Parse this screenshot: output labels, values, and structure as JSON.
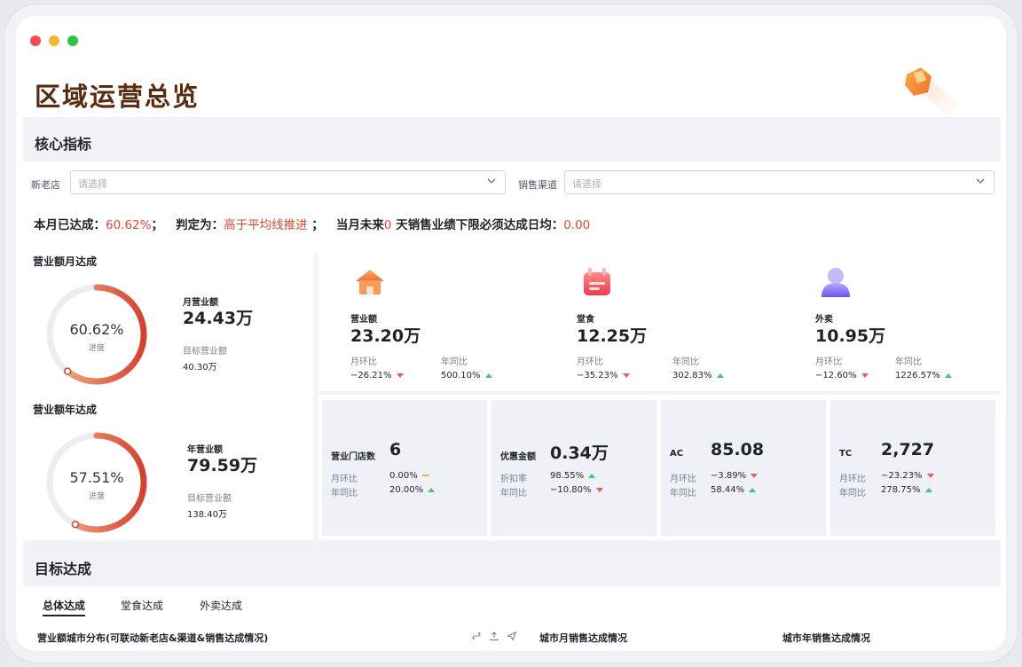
{
  "page": {
    "title": "区域运营总览"
  },
  "sections": {
    "core": "核心指标",
    "target": "目标达成"
  },
  "filters": {
    "store_type_label": "新老店",
    "store_type_placeholder": "请选择",
    "channel_label": "销售渠道",
    "channel_placeholder": "请选择"
  },
  "status": {
    "prefix": "本月已达成：",
    "achieved": "60.62%",
    "sep1": "；",
    "judge_label": "判定为：",
    "judge_value": "高于平均线推进",
    "sep2": "；",
    "future_prefix": "当月未来",
    "future_days": "0",
    "future_suffix": " 天销售业绩下限必须达成日均：",
    "daily_min": "0.00"
  },
  "monthly_gauge": {
    "title": "营业额月达成",
    "percent_text": "60.62%",
    "progress": 0.6062,
    "sub": "进度",
    "value_label": "月营业额",
    "value": "24.43万",
    "target_label": "目标营业额",
    "target_value": "40.30万"
  },
  "yearly_gauge": {
    "title": "营业额年达成",
    "percent_text": "57.51%",
    "progress": 0.5751,
    "sub": "进度",
    "value_label": "年营业额",
    "value": "79.59万",
    "target_label": "目标营业额",
    "target_value": "138.40万"
  },
  "kpis": [
    {
      "icon": "shop-icon",
      "label": "营业额",
      "value": "23.20万",
      "mom_label": "月环比",
      "mom": "−26.21%",
      "mom_trend": "down",
      "yoy_label": "年同比",
      "yoy": "500.10%",
      "yoy_trend": "up"
    },
    {
      "icon": "dine-in-icon",
      "label": "堂食",
      "value": "12.25万",
      "mom_label": "月环比",
      "mom": "−35.23%",
      "mom_trend": "down",
      "yoy_label": "年同比",
      "yoy": "302.83%",
      "yoy_trend": "up"
    },
    {
      "icon": "delivery-icon",
      "label": "外卖",
      "value": "10.95万",
      "mom_label": "月环比",
      "mom": "−12.60%",
      "mom_trend": "down",
      "yoy_label": "年同比",
      "yoy": "1226.57%",
      "yoy_trend": "up"
    }
  ],
  "small_cards": [
    {
      "label": "营业门店数",
      "value": "6",
      "r1_label": "月环比",
      "r1": "0.00%",
      "r1_trend": "flat",
      "r2_label": "年同比",
      "r2": "20.00%",
      "r2_trend": "up"
    },
    {
      "label": "优惠金额",
      "value": "0.34万",
      "r1_label": "折扣率",
      "r1": "98.55%",
      "r1_trend": "up",
      "r2_label": "年同比",
      "r2": "−10.80%",
      "r2_trend": "down"
    },
    {
      "label": "AC",
      "value": "85.08",
      "r1_label": "月环比",
      "r1": "−3.89%",
      "r1_trend": "down",
      "r2_label": "年同比",
      "r2": "58.44%",
      "r2_trend": "up"
    },
    {
      "label": "TC",
      "value": "2,727",
      "r1_label": "月环比",
      "r1": "−23.23%",
      "r1_trend": "down",
      "r2_label": "年同比",
      "r2": "278.75%",
      "r2_trend": "up"
    }
  ],
  "tabs": [
    "总体达成",
    "堂食达成",
    "外卖达成"
  ],
  "subtitles": {
    "left": "营业额城市分布(可联动新老店&渠道&销售达成情况)",
    "middle": "城市月销售达成情况",
    "right": "城市年销售达成情况"
  },
  "colors": {
    "title": "#5a2c0f",
    "accent_red": "#e04a2d",
    "gauge_start": "#f0b98a",
    "gauge_end": "#d8402e",
    "up": "#4bc46b",
    "down": "#ee5b52"
  }
}
